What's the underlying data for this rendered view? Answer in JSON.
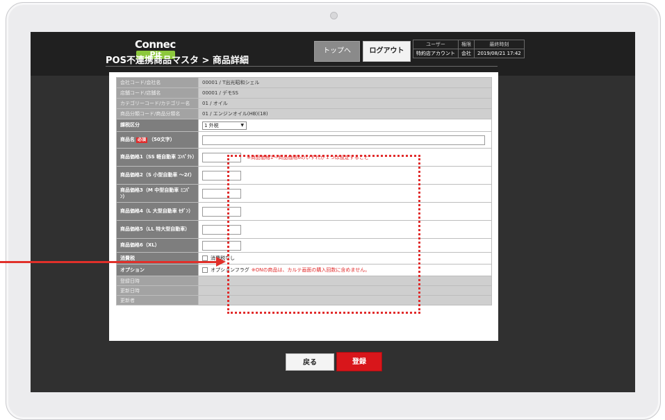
{
  "header": {
    "logo_line1": "Connec",
    "logo_line2": "Pit",
    "top_button": "トップへ",
    "logout_button": "ログアウト",
    "info_headers": [
      "ユーザー",
      "権限",
      "最終時刻"
    ],
    "info_values": [
      "特約店アカウント",
      "会社",
      "2019/08/21 17:42"
    ]
  },
  "page": {
    "title": "POS不連携商品マスタ > 商品詳細"
  },
  "form": {
    "company_label": "会社コード/会社名",
    "company_value": "00001 / T出光昭和シェル",
    "store_label": "店舗コード/店舗名",
    "store_value": "00001 / デモSS",
    "category_label": "カテゴリーコード/カテゴリー名",
    "category_value": "01 / オイル",
    "subcategory_label": "商品分類コード/商品分類名",
    "subcategory_value": "01 / エンジンオイル(HB)(18)",
    "tax_type_label": "課税区分",
    "tax_type_value": "1 外税",
    "product_name_label": "商品名",
    "required_badge": "必須",
    "product_name_suffix": "（50文字）",
    "price1_label": "商品価格1（SS 軽自動車 ｺﾝﾊﾟｸﾄ）",
    "price_note": "※商品価格1～商品価格6のいずれか１つは設定すること",
    "price2_label": "商品価格2（S 小型自動車 ～2ℓ）",
    "price3_label": "商品価格3（M 中型自動車 ﾐﾆﾊﾞﾝ）",
    "price4_label": "商品価格4（L 大型自動車 ｾﾀﾞﾝ）",
    "price5_label": "商品価格5（LL 特大型自動車）",
    "price6_label": "商品価格6（XL）",
    "consumption_tax_label": "消費税",
    "consumption_tax_check": "消費税なし",
    "option_label": "オプション",
    "option_check": "オプションフラグ",
    "option_note": "※ONの商品は、カルテ画面の購入回数に含めません。",
    "registered_at_label": "登録日時",
    "updated_at_label": "更新日時",
    "updated_by_label": "更新者"
  },
  "buttons": {
    "back": "戻る",
    "register": "登録"
  },
  "colors": {
    "accent": "#d8161b",
    "annotation": "#e12b2b",
    "logo_green": "#8cc83c"
  }
}
